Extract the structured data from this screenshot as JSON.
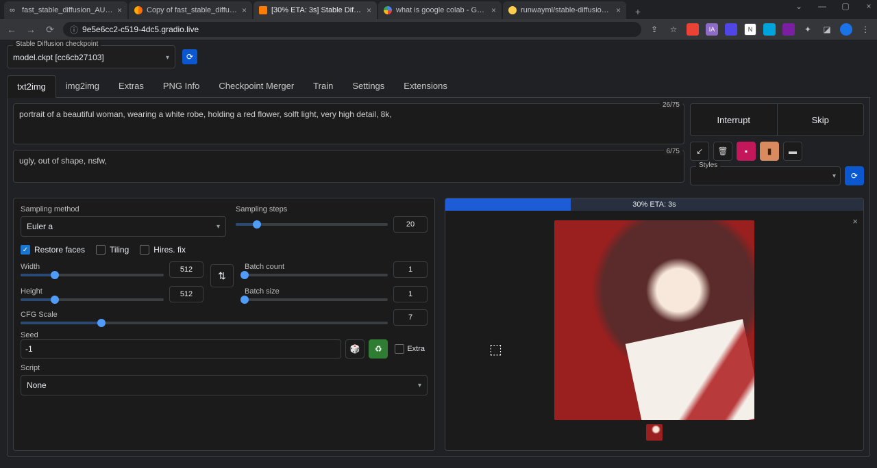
{
  "browser": {
    "tabs": [
      {
        "title": "fast_stable_diffusion_AUTOMA"
      },
      {
        "title": "Copy of fast_stable_diffusion"
      },
      {
        "title": "[30% ETA: 3s] Stable Diffusion"
      },
      {
        "title": "what is google colab - Google"
      },
      {
        "title": "runwayml/stable-diffusion-v1"
      }
    ],
    "active_tab_index": 2,
    "url": "9e5e6cc2-c519-4dc5.gradio.live"
  },
  "checkpoint": {
    "label": "Stable Diffusion checkpoint",
    "value": "model.ckpt [cc6cb27103]"
  },
  "main_tabs": [
    "txt2img",
    "img2img",
    "Extras",
    "PNG Info",
    "Checkpoint Merger",
    "Train",
    "Settings",
    "Extensions"
  ],
  "active_main_tab": 0,
  "prompt": {
    "text": "portrait of a beautiful woman, wearing a white robe, holding a red flower, solft light, very high detail, 8k,",
    "token_count": "26/75"
  },
  "neg_prompt": {
    "text": "ugly, out of shape, nsfw,",
    "token_count": "6/75"
  },
  "buttons": {
    "interrupt": "Interrupt",
    "skip": "Skip"
  },
  "styles_label": "Styles",
  "sampling": {
    "method_label": "Sampling method",
    "method_value": "Euler a",
    "steps_label": "Sampling steps",
    "steps_value": "20",
    "steps_pct": 14
  },
  "checks": {
    "restore_faces": {
      "label": "Restore faces",
      "checked": true
    },
    "tiling": {
      "label": "Tiling",
      "checked": false
    },
    "hires": {
      "label": "Hires. fix",
      "checked": false
    }
  },
  "dims": {
    "width_label": "Width",
    "width_value": "512",
    "width_pct": 24,
    "height_label": "Height",
    "height_value": "512",
    "height_pct": 24,
    "batch_count_label": "Batch count",
    "batch_count_value": "1",
    "batch_count_pct": 0,
    "batch_size_label": "Batch size",
    "batch_size_value": "1",
    "batch_size_pct": 0
  },
  "cfg": {
    "label": "CFG Scale",
    "value": "7",
    "pct": 22
  },
  "seed": {
    "label": "Seed",
    "value": "-1",
    "extra_label": "Extra"
  },
  "script": {
    "label": "Script",
    "value": "None"
  },
  "progress": {
    "text": "30% ETA: 3s",
    "pct": 30
  }
}
